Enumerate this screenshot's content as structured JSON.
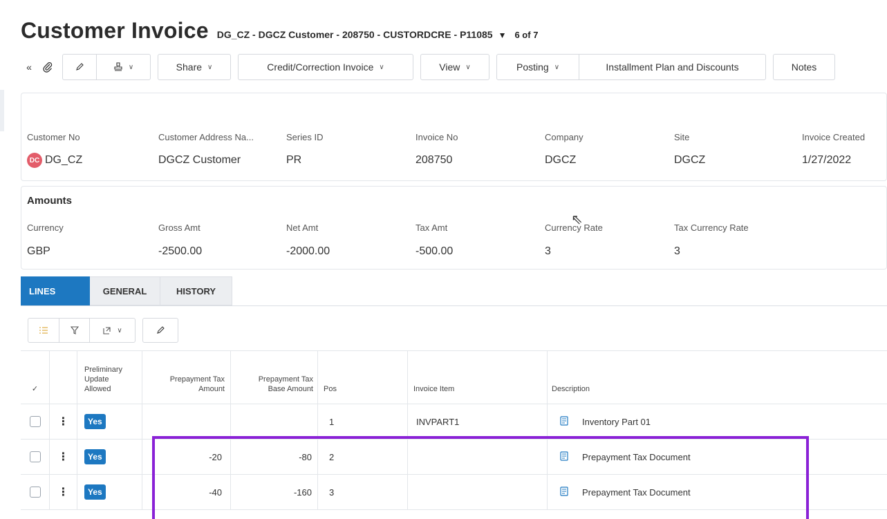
{
  "header": {
    "title": "Customer Invoice",
    "subtitle": "DG_CZ - DGCZ Customer - 208750 - CUSTORDCRE - P11085",
    "record_count": "6 of 7"
  },
  "toolbar": {
    "share_label": "Share",
    "credit_label": "Credit/Correction Invoice",
    "view_label": "View",
    "posting_label": "Posting",
    "installment_label": "Installment Plan and Discounts",
    "notes_label": "Notes"
  },
  "summary": {
    "customer_no_label": "Customer No",
    "customer_no_value": "DG_CZ",
    "customer_avatar": "DC",
    "address_label": "Customer Address Na...",
    "address_value": "DGCZ Customer",
    "series_label": "Series ID",
    "series_value": "PR",
    "invoice_no_label": "Invoice No",
    "invoice_no_value": "208750",
    "company_label": "Company",
    "company_value": "DGCZ",
    "site_label": "Site",
    "site_value": "DGCZ",
    "created_label": "Invoice Created",
    "created_value": "1/27/2022"
  },
  "amounts": {
    "section_title": "Amounts",
    "currency_label": "Currency",
    "currency_value": "GBP",
    "gross_label": "Gross Amt",
    "gross_value": "-2500.00",
    "net_label": "Net Amt",
    "net_value": "-2000.00",
    "tax_label": "Tax Amt",
    "tax_value": "-500.00",
    "rate_label": "Currency Rate",
    "rate_value": "3",
    "tax_rate_label": "Tax Currency Rate",
    "tax_rate_value": "3"
  },
  "tabs": [
    {
      "label": "LINES"
    },
    {
      "label": "GENERAL"
    },
    {
      "label": "HISTORY"
    }
  ],
  "grid": {
    "headers": {
      "preliminary": "Preliminary Update Allowed",
      "prep_tax_amount": "Prepayment Tax Amount",
      "prep_tax_base": "Prepayment Tax Base Amount",
      "pos": "Pos",
      "invoice_item": "Invoice Item",
      "description": "Description"
    },
    "rows": [
      {
        "preliminary": "Yes",
        "prep_tax_amount": "",
        "prep_tax_base": "",
        "pos": "1",
        "invoice_item": "INVPART1",
        "description": "Inventory Part 01"
      },
      {
        "preliminary": "Yes",
        "prep_tax_amount": "-20",
        "prep_tax_base": "-80",
        "pos": "2",
        "invoice_item": "",
        "description": "Prepayment Tax Document"
      },
      {
        "preliminary": "Yes",
        "prep_tax_amount": "-40",
        "prep_tax_base": "-160",
        "pos": "3",
        "invoice_item": "",
        "description": "Prepayment Tax Document"
      }
    ]
  },
  "colors": {
    "accent": "#1d78c1",
    "highlight": "#8a21d6",
    "avatar": "#e35d6a"
  }
}
